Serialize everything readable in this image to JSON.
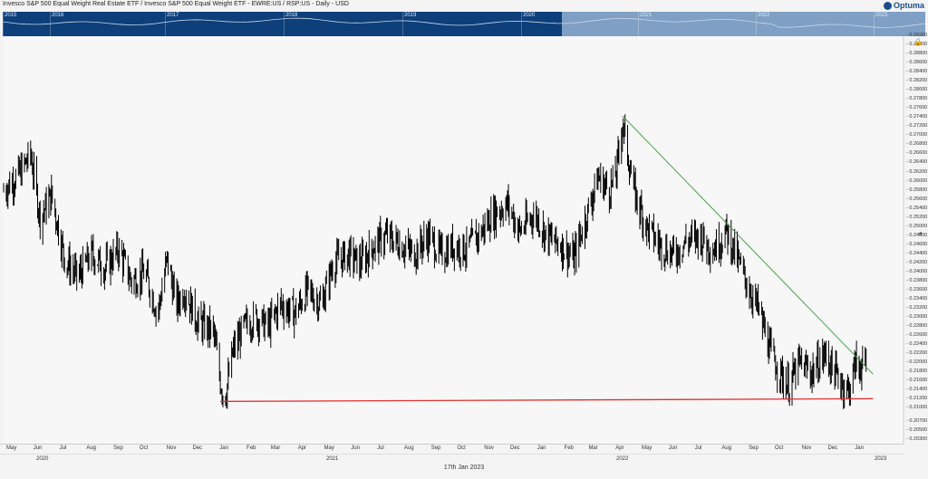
{
  "header": {
    "title": "Invesco S&P 500 Equal Weight Real Estate ETF / Invesco S&P 500 Equal Weight ETF - EWRE:US / RSP:US - Daily - USD",
    "logo_text": "Optuma"
  },
  "navigator": {
    "years": [
      "2015",
      "2016",
      "2017",
      "2018",
      "2019",
      "2020",
      "2021",
      "2022",
      "2023"
    ],
    "bg_color": "#0d3f7a",
    "window_color": "#7f9fc4"
  },
  "footer": {
    "date": "17th Jan 2023"
  },
  "icons": {
    "lock": "lock-icon",
    "arrow": "chevron-left-icon"
  },
  "colors": {
    "price": "#000000",
    "downtrend": "#3a9a3a",
    "support": "#e03030"
  },
  "chart_data": {
    "type": "bar",
    "subtype": "ohlc",
    "title": "Invesco S&P 500 Equal Weight Real Estate ETF / Invesco S&P 500 Equal Weight ETF - EWRE:US / RSP:US - Daily - USD",
    "ylim": [
      0.2025,
      0.292
    ],
    "y_ticks": [
      "0.29200",
      "0.29000",
      "0.28800",
      "0.28600",
      "0.28400",
      "0.28200",
      "0.28000",
      "0.27800",
      "0.27600",
      "0.27400",
      "0.27200",
      "0.27000",
      "0.26800",
      "0.26600",
      "0.26400",
      "0.26200",
      "0.26000",
      "0.25800",
      "0.25600",
      "0.25400",
      "0.25200",
      "0.25000",
      "0.24800",
      "0.24600",
      "0.24400",
      "0.24200",
      "0.24000",
      "0.23800",
      "0.23600",
      "0.23400",
      "0.23200",
      "0.23000",
      "0.22800",
      "0.22600",
      "0.22400",
      "0.22200",
      "0.22000",
      "0.21800",
      "0.21600",
      "0.21400",
      "0.21200",
      "0.21000",
      "0.20700",
      "0.20500",
      "0.20300"
    ],
    "months": [
      "May",
      "Jun",
      "Jul",
      "Aug",
      "Sep",
      "Oct",
      "Nov",
      "Dec",
      "Jan",
      "Feb",
      "Mar",
      "Apr",
      "May",
      "Jun",
      "Jul",
      "Aug",
      "Sep",
      "Oct",
      "Nov",
      "Dec",
      "Jan",
      "Feb",
      "Mar",
      "Apr",
      "May",
      "Jun",
      "Jul",
      "Aug",
      "Sep",
      "Oct",
      "Nov",
      "Dec",
      "Jan"
    ],
    "years": [
      "2020",
      "2021",
      "2022",
      "2023"
    ],
    "series": [
      {
        "values": [
          [
            "2020-05-01",
            0.258
          ],
          [
            "2020-05-20",
            0.262
          ],
          [
            "2020-06-01",
            0.266
          ],
          [
            "2020-06-12",
            0.252
          ],
          [
            "2020-06-25",
            0.257
          ],
          [
            "2020-07-10",
            0.243
          ],
          [
            "2020-07-25",
            0.239
          ],
          [
            "2020-08-10",
            0.244
          ],
          [
            "2020-08-25",
            0.241
          ],
          [
            "2020-09-10",
            0.245
          ],
          [
            "2020-09-25",
            0.238
          ],
          [
            "2020-10-10",
            0.24
          ],
          [
            "2020-10-25",
            0.231
          ],
          [
            "2020-11-05",
            0.243
          ],
          [
            "2020-11-15",
            0.233
          ],
          [
            "2020-11-25",
            0.236
          ],
          [
            "2020-12-10",
            0.229
          ],
          [
            "2020-12-28",
            0.227
          ],
          [
            "2021-01-05",
            0.216
          ],
          [
            "2021-01-10",
            0.212
          ],
          [
            "2021-01-20",
            0.223
          ],
          [
            "2021-02-01",
            0.228
          ],
          [
            "2021-02-15",
            0.23
          ],
          [
            "2021-03-01",
            0.228
          ],
          [
            "2021-03-15",
            0.233
          ],
          [
            "2021-04-01",
            0.231
          ],
          [
            "2021-04-15",
            0.236
          ],
          [
            "2021-05-01",
            0.233
          ],
          [
            "2021-05-15",
            0.242
          ],
          [
            "2021-06-01",
            0.244
          ],
          [
            "2021-06-15",
            0.242
          ],
          [
            "2021-07-01",
            0.246
          ],
          [
            "2021-07-15",
            0.248
          ],
          [
            "2021-08-01",
            0.246
          ],
          [
            "2021-08-15",
            0.244
          ],
          [
            "2021-09-01",
            0.248
          ],
          [
            "2021-09-15",
            0.244
          ],
          [
            "2021-10-01",
            0.246
          ],
          [
            "2021-10-15",
            0.245
          ],
          [
            "2021-11-01",
            0.249
          ],
          [
            "2021-11-15",
            0.253
          ],
          [
            "2021-12-01",
            0.255
          ],
          [
            "2021-12-15",
            0.249
          ],
          [
            "2022-01-01",
            0.253
          ],
          [
            "2022-01-15",
            0.248
          ],
          [
            "2022-02-01",
            0.246
          ],
          [
            "2022-02-15",
            0.243
          ],
          [
            "2022-03-01",
            0.252
          ],
          [
            "2022-03-15",
            0.261
          ],
          [
            "2022-03-28",
            0.258
          ],
          [
            "2022-04-05",
            0.262
          ],
          [
            "2022-04-12",
            0.273
          ],
          [
            "2022-04-25",
            0.258
          ],
          [
            "2022-05-10",
            0.25
          ],
          [
            "2022-05-25",
            0.246
          ],
          [
            "2022-06-10",
            0.244
          ],
          [
            "2022-06-25",
            0.247
          ],
          [
            "2022-07-10",
            0.248
          ],
          [
            "2022-07-25",
            0.245
          ],
          [
            "2022-08-10",
            0.249
          ],
          [
            "2022-08-20",
            0.244
          ],
          [
            "2022-09-01",
            0.238
          ],
          [
            "2022-09-15",
            0.232
          ],
          [
            "2022-09-30",
            0.222
          ],
          [
            "2022-10-10",
            0.218
          ],
          [
            "2022-10-20",
            0.215
          ],
          [
            "2022-11-01",
            0.22
          ],
          [
            "2022-11-15",
            0.218
          ],
          [
            "2022-12-01",
            0.222
          ],
          [
            "2022-12-15",
            0.217
          ],
          [
            "2022-12-28",
            0.214
          ],
          [
            "2023-01-05",
            0.22
          ],
          [
            "2023-01-17",
            0.219
          ]
        ]
      }
    ],
    "annotations": [
      {
        "type": "trendline",
        "color": "green",
        "from": [
          "2022-04-12",
          0.2745
        ],
        "to": [
          "2023-01-25",
          0.2176
        ]
      },
      {
        "type": "support",
        "color": "red",
        "from": [
          "2021-01-05",
          0.2116
        ],
        "to": [
          "2023-01-25",
          0.2122
        ]
      }
    ],
    "grid": false,
    "legend": "none"
  }
}
